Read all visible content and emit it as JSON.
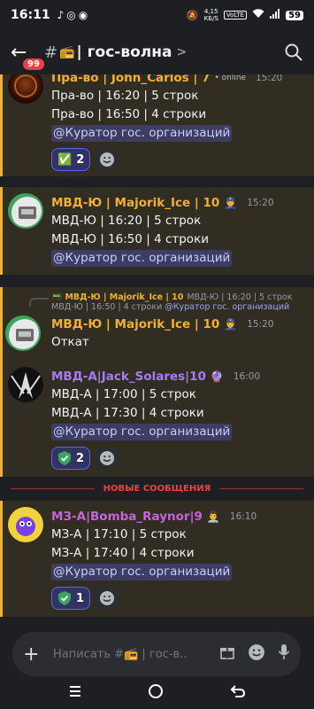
{
  "status": {
    "time": "16:11",
    "speed": "4,15\nКБ/S",
    "volte": "VoLTE",
    "battery": "59"
  },
  "header": {
    "unread_badge": "99",
    "hash": "#",
    "channel_icon": "📻",
    "channel_name": "гос-волна",
    "chevron": ">"
  },
  "messages": [
    {
      "author": "Пра-во | John_Carlos | 7",
      "tag": "• online",
      "time": "15:20",
      "lines": [
        "Пра-во | 16:20 | 5 строк",
        "Пра-во | 16:50 | 4 строки"
      ],
      "mention": "@Куратор гос. организаций",
      "reaction": {
        "emoji": "✅",
        "count": "2"
      }
    },
    {
      "author": "МВД-Ю | Majorik_Ice | 10",
      "tag": "👮",
      "time": "15:20",
      "lines": [
        "МВД-Ю | 16:20 | 5 строк",
        "МВД-Ю | 16:50 | 4 строки"
      ],
      "mention": "@Куратор гос. организаций"
    },
    {
      "reply_author": "МВД-Ю | Majorik_Ice | 10",
      "reply_text": "МВД-Ю | 16:20 | 5 строк",
      "reply_line2": "МВД-Ю | 16:50 | 4 строки",
      "reply_mention": "@Куратор гос. организаций",
      "author": "МВД-Ю | Majorik_Ice | 10",
      "tag": "👮",
      "time": "15:20",
      "lines": [
        "Откат"
      ]
    },
    {
      "author": "МВД-А|Jack_Solares|10",
      "tag": "🔮",
      "time": "16:00",
      "lines": [
        "МВД-А | 17:00 | 5 строк",
        "МВД-А | 17:30 | 4 строки"
      ],
      "mention": "@Куратор гос. организаций",
      "reaction": {
        "emoji": "✔",
        "count": "2"
      }
    },
    {
      "author": "МЗ-А|Bomba_Raynor|9",
      "tag": "👨‍⚕️",
      "time": "16:10",
      "lines": [
        "МЗ-А | 17:10 | 5 строк",
        "МЗ-А | 17:40 | 4 строки"
      ],
      "mention": "@Куратор гос. организаций",
      "reaction": {
        "emoji": "✔",
        "count": "1"
      }
    }
  ],
  "divider": "НОВЫЕ СООБЩЕНИЯ",
  "composer": {
    "placeholder": "Написать #📻 | гос-в..."
  },
  "colors": {
    "gold": "#f0b132",
    "purple": "#a67cf0",
    "magenta": "#c465d6",
    "mention_bg": "#4e5097",
    "accent": "#5865f2"
  }
}
